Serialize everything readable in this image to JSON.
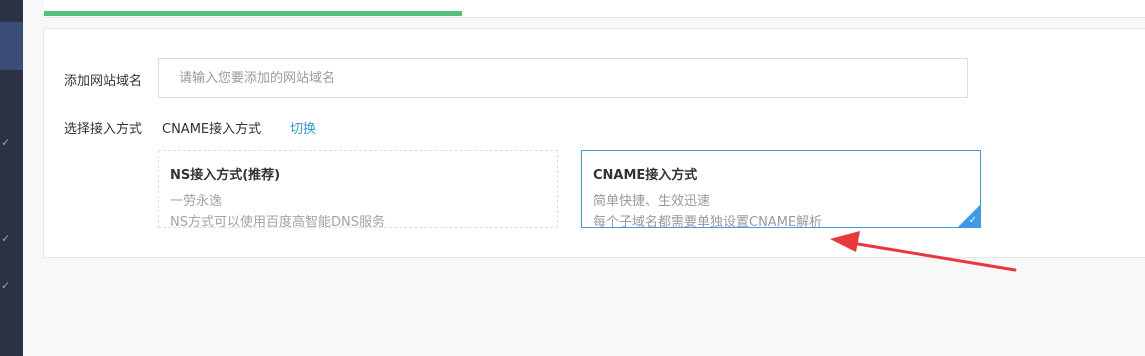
{
  "form": {
    "domain_label": "添加网站域名",
    "domain_placeholder": "请输入您要添加的网站域名",
    "domain_value": "",
    "method_label": "选择接入方式",
    "method_current": "CNAME接入方式",
    "switch_link": "切换"
  },
  "options": {
    "ns": {
      "title": "NS接入方式(推荐)",
      "desc1": "一劳永逸",
      "desc2": "NS方式可以使用百度高智能DNS服务",
      "selected": false
    },
    "cname": {
      "title": "CNAME接入方式",
      "desc1": "简单快捷、生效迅速",
      "desc2": "每个子域名都需要单独设置CNAME解析",
      "selected": true
    }
  },
  "progress": {
    "fraction": 0.38,
    "color": "#52c27a"
  },
  "colors": {
    "accent": "#3d9be9",
    "link": "#2d9cdb",
    "annotation": "#e8383d",
    "sidebar": "#2b3244"
  },
  "icons": {
    "check": "checkmark-icon",
    "arrow": "annotation-arrow"
  }
}
